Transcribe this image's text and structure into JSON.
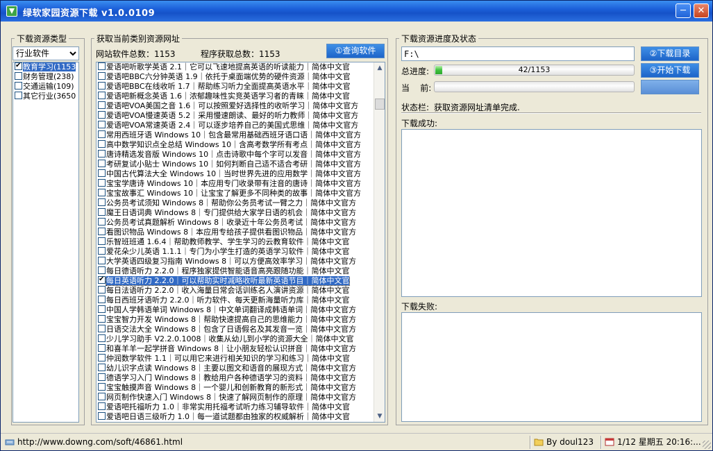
{
  "window": {
    "title": "绿软家园资源下载  v1.0.0109",
    "controls": {
      "minimize": "─",
      "close": "✕"
    }
  },
  "left": {
    "legend": "下载资源类型",
    "combo_value": "行业软件",
    "categories": [
      {
        "label": "教育学习(1153",
        "checked": true,
        "selected": true
      },
      {
        "label": "财务管理(238)",
        "checked": false,
        "selected": false
      },
      {
        "label": "交通运输(109)",
        "checked": false,
        "selected": false
      },
      {
        "label": "其它行业(3650",
        "checked": false,
        "selected": false
      }
    ]
  },
  "middle": {
    "legend": "获取当前类别资源网址",
    "total_label": "网站软件总数：1153",
    "fetched_label": "程序获取总数：1153",
    "query_button": "①查询软件",
    "items": [
      {
        "text": "爱语吧听歌学英语 2.1｜它可以飞速地提高英语的听读能力｜简体中文官",
        "checked": false
      },
      {
        "text": "爱语吧BBC六分钟英语 1.9｜依托于桌面端优势的硬件资源｜简体中文官",
        "checked": false
      },
      {
        "text": "爱语吧BBC在线收听 1.7｜帮助练习听力全面提高英语水平｜简体中文官",
        "checked": false
      },
      {
        "text": "爱语吧新概念英语 1.6｜浓郁趣味性实竞英语学习者的青睐｜简体中文官",
        "checked": false
      },
      {
        "text": "爱语吧VOA美国之音 1.6｜可以按照爱好选择性的收听学习｜简体中文官方",
        "checked": false
      },
      {
        "text": "爱语吧VOA慢速英语 5.2｜采用慢速朗读、最好的听力教师｜简体中文官方",
        "checked": false
      },
      {
        "text": "爱语吧VOA常速英语 2.4｜可以逐步培养自己的美国式思维｜简体中文官方",
        "checked": false
      },
      {
        "text": "常用西班牙语 Windows 10｜包含最常用基础西班牙语口语｜简体中文官方",
        "checked": false
      },
      {
        "text": "高中数学知识点全总结 Windows 10｜含高考数学所有考点｜简体中文官方",
        "checked": false
      },
      {
        "text": "唐诗精选发音版 Windows 10｜点击诗歌中每个字可以发音｜简体中文官方",
        "checked": false
      },
      {
        "text": "考研复试小贴士 Windows 10｜如何判断自己适不适合考研｜简体中文官方",
        "checked": false
      },
      {
        "text": "中国古代算法大全 Windows 10｜当时世界先进的应用数学｜简体中文官方",
        "checked": false
      },
      {
        "text": "宝宝学唐诗 Windows 10｜本应用专门收录带有注音的唐诗｜简体中文官方",
        "checked": false
      },
      {
        "text": "宝宝故事汇 Windows 10｜让宝宝了解更多不同种类的故事｜简体中文官方",
        "checked": false
      },
      {
        "text": "公务员考试须知 Windows 8｜帮助你公务员考试一臂之力｜简体中文官方",
        "checked": false
      },
      {
        "text": "魔王日语词典 Windows 8｜专门提供给大家学日语的机会｜简体中文官方",
        "checked": false
      },
      {
        "text": "公务员考试真题解析 Windows 8｜收录近十年公务员考试｜简体中文官方",
        "checked": false
      },
      {
        "text": "看图识物品 Windows 8｜本应用专给孩子提供看图识物品｜简体中文官方",
        "checked": false
      },
      {
        "text": "乐智班班通 1.6.4｜帮助教师教学、学生学习的云教育软件｜简体中文官",
        "checked": false
      },
      {
        "text": "爱花朵少儿英语 1.1.1｜专门为小学生打造的英语学习软件｜简体中文官",
        "checked": false
      },
      {
        "text": "大学英语四级复习指南 Windows 8｜可以方便高效率学习｜简体中文官方",
        "checked": false
      },
      {
        "text": "每日德语听力 2.2.0｜程序独家提供智能语音高亮跟随功能｜简体中文官",
        "checked": false
      },
      {
        "text": "每日英语听力 2.2.0｜可以帮助实时减略收听最新英语节目｜简体中文官",
        "checked": true,
        "selected": true
      },
      {
        "text": "每日法语听力 2.2.0｜收入海量日常会话训练名人演讲资源｜简体中文官",
        "checked": false
      },
      {
        "text": "每日西班牙语听力 2.2.0｜听力软件、每天更新海量听力库｜简体中文官",
        "checked": false
      },
      {
        "text": "中国人学韩语单词 Windows 8｜中文单词翻译成韩语单词｜简体中文官方",
        "checked": false
      },
      {
        "text": "宝宝智力开发 Windows 8｜帮助快速提高自己的思维能力｜简体中文官方",
        "checked": false
      },
      {
        "text": "日语交法大全 Windows 8｜包含了日语假名及其发音一览｜简体中文官方",
        "checked": false
      },
      {
        "text": "少儿学习助手 V2.2.0.1008｜收集从幼儿到小学的资源大全｜简体中文官",
        "checked": false
      },
      {
        "text": "和喜羊羊一起学拼音 Windows 8｜让小朋友轻松认识拼音｜简体中文官方",
        "checked": false
      },
      {
        "text": "仲润数学软件 1.1｜可以用它来进行相关知识的学习和练习｜简体中文官",
        "checked": false
      },
      {
        "text": "幼儿识字点读 Windows 8｜主要以图文和语音的展现方式｜简体中文官方",
        "checked": false
      },
      {
        "text": "德语学习入门 Windows 8｜教给用户各种德语学习的资料｜简体中文官方",
        "checked": false
      },
      {
        "text": "宝宝触摸声音 Windows 8｜一个婴儿和创新教育的新形式｜简体中文官方",
        "checked": false
      },
      {
        "text": "网页制作快速入门 Windows 8｜快速了解网页制作的原理｜简体中文官方",
        "checked": false
      },
      {
        "text": "爱语吧托福听力 1.0｜非常实用托福考试听力练习辅导软件｜简体中文官",
        "checked": false
      },
      {
        "text": "爱语吧日语三级听力 1.0｜每一道试题都由独家的权威解析｜简体中文官",
        "checked": false
      }
    ]
  },
  "right": {
    "legend": "下载资源进度及状态",
    "path_value": "F:\\",
    "dir_button": "②下载目录",
    "start_button": "③开始下载",
    "blank_button": "",
    "total_progress_label": "总进度:",
    "total_progress_text": "42/1153",
    "total_progress_fraction": 0.0364,
    "current_label": "当    前:",
    "current_progress_fraction": 0,
    "status_label": "状态栏:",
    "status_text": "获取资源网址清单完成.",
    "success_label": "下载成功:",
    "fail_label": "下载失败:"
  },
  "statusbar": {
    "url": "http://www.downg.com/soft/46861.html",
    "author": "By doul123",
    "datetime": "1/12 星期五 20:16:..."
  }
}
